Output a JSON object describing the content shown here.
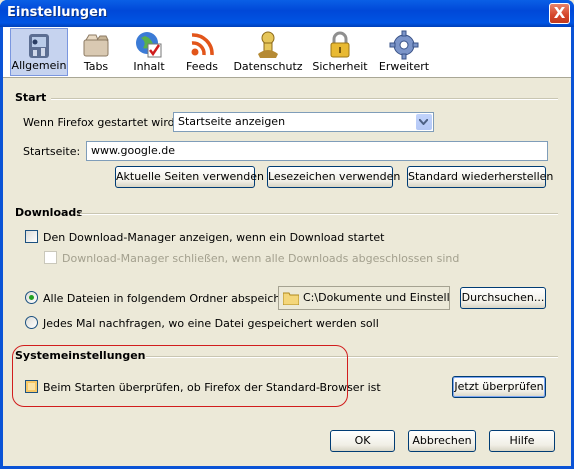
{
  "window": {
    "title": "Einstellungen",
    "close": "X"
  },
  "toolbar": {
    "items": [
      {
        "label": "Allgemein",
        "icon": "general-icon"
      },
      {
        "label": "Tabs",
        "icon": "tabs-icon"
      },
      {
        "label": "Inhalt",
        "icon": "content-icon"
      },
      {
        "label": "Feeds",
        "icon": "feeds-icon"
      },
      {
        "label": "Datenschutz",
        "icon": "privacy-icon"
      },
      {
        "label": "Sicherheit",
        "icon": "padlock-icon"
      },
      {
        "label": "Erweitert",
        "icon": "gear-icon"
      }
    ]
  },
  "start": {
    "heading": "Start",
    "when_label": "Wenn Firefox gestartet wird:",
    "when_value": "Startseite anzeigen",
    "homepage_label": "Startseite:",
    "homepage_value": "www.google.de",
    "btn_current": "Aktuelle Seiten verwenden",
    "btn_bookmark": "Lesezeichen verwenden",
    "btn_restore": "Standard wiederherstellen"
  },
  "downloads": {
    "heading": "Downloads",
    "show_manager": "Den Download-Manager anzeigen, wenn ein Download startet",
    "close_manager": "Download-Manager schließen, wenn alle Downloads abgeschlossen sind",
    "save_all": "Alle Dateien in folgendem Ordner abspeichern:",
    "folder": "C:\\Dokumente und Einstellungen",
    "browse": "Durchsuchen...",
    "ask_each": "Jedes Mal nachfragen, wo eine Datei gespeichert werden soll"
  },
  "system": {
    "heading": "Systemeinstellungen",
    "check_default": "Beim Starten überprüfen, ob Firefox der Standard-Browser ist",
    "check_now": "Jetzt überprüfen"
  },
  "footer": {
    "ok": "OK",
    "cancel": "Abbrechen",
    "help": "Hilfe"
  },
  "colors": {
    "titlebar": "#0054e3",
    "dialog_bg": "#ece9d8",
    "highlight": "#d11d1d"
  }
}
